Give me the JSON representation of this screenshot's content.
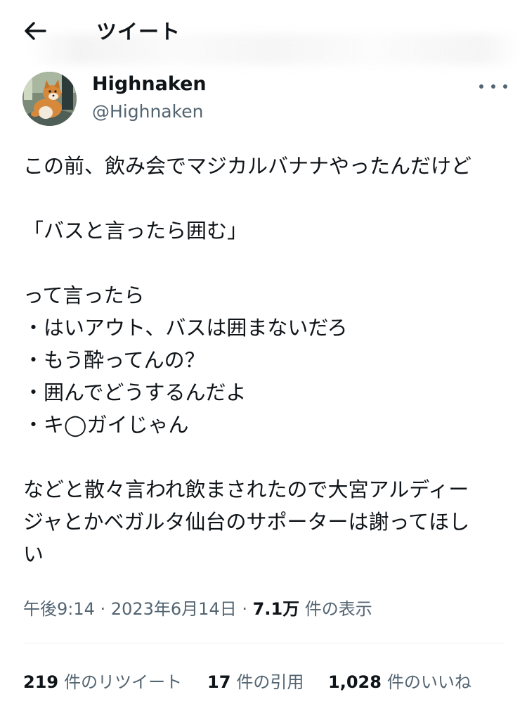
{
  "header": {
    "title": "ツイート",
    "back_icon": "arrow-left-icon"
  },
  "author": {
    "display_name": "Highnaken",
    "handle": "@Highnaken",
    "avatar": "shiba-inu-avatar"
  },
  "tweet": {
    "lines": {
      "l1": "この前、飲み会でマジカルバナナやったんだけど",
      "l2": "「バスと言ったら囲む」",
      "l3": "って言ったら",
      "l4": "・はいアウト、バスは囲まないだろ",
      "l5": "・もう酔ってんの？",
      "l6": "・囲んでどうするんだよ",
      "l7": "・キ◯ガイじゃん",
      "l8": "などと散々言われ飲まされたので大宮アルディー",
      "l9": "ジャとかベガルタ仙台のサポーターは謝ってほし",
      "l10": "い"
    }
  },
  "meta": {
    "time": "午後9:14",
    "separator": "·",
    "date": "2023年6月14日",
    "views_count": "7.1万",
    "views_label": "件の表示"
  },
  "stats": {
    "retweets_count": "219",
    "retweets_label": "件のリツイート",
    "quotes_count": "17",
    "quotes_label": "件の引用",
    "likes_count": "1,028",
    "likes_label": "件のいいね"
  },
  "colors": {
    "text": "#0f1419",
    "secondary": "#536471",
    "divider": "#eff3f4"
  }
}
